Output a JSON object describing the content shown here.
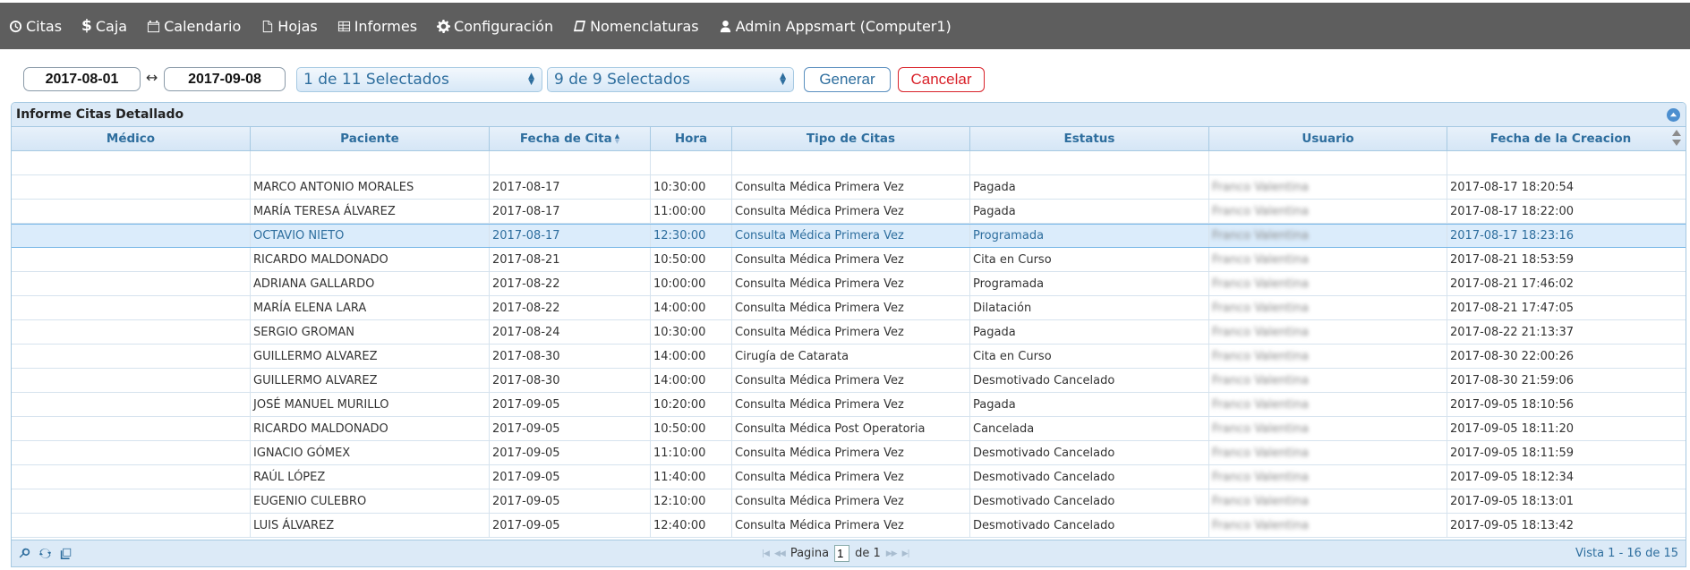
{
  "nav": {
    "items": [
      {
        "label": "Citas",
        "icon": "clock-icon"
      },
      {
        "label": "Caja",
        "icon": "dollar-icon"
      },
      {
        "label": "Calendario",
        "icon": "calendar-icon"
      },
      {
        "label": "Hojas",
        "icon": "file-icon"
      },
      {
        "label": "Informes",
        "icon": "table-icon"
      },
      {
        "label": "Configuración",
        "icon": "gear-icon"
      },
      {
        "label": "Nomenclaturas",
        "icon": "book-icon"
      },
      {
        "label": "Admin Appsmart (Computer1)",
        "icon": "user-icon"
      }
    ]
  },
  "filters": {
    "date_from": "2017-08-01",
    "date_sep": "↔",
    "date_to": "2017-09-08",
    "select1": "1 de 11 Selectados",
    "select2": "9 de 9 Selectados",
    "generate": "Generar",
    "cancel": "Cancelar"
  },
  "grid": {
    "caption": "Informe Citas Detallado",
    "columns": [
      "Médico",
      "Paciente",
      "Fecha de Cita",
      "Hora",
      "Tipo de Citas",
      "Estatus",
      "Usuario",
      "Fecha de la Creacion"
    ],
    "rows": [
      {
        "medico": "",
        "paciente": "MARCO ANTONIO MORALES",
        "fecha": "2017-08-17",
        "hora": "10:30:00",
        "tipo": "Consulta Médica Primera Vez",
        "estatus": "Pagada",
        "usuario": "Franco Valentina",
        "creacion": "2017-08-17 18:20:54"
      },
      {
        "medico": "",
        "paciente": "MARÍA TERESA ÁLVAREZ",
        "fecha": "2017-08-17",
        "hora": "11:00:00",
        "tipo": "Consulta Médica Primera Vez",
        "estatus": "Pagada",
        "usuario": "Franco Valentina",
        "creacion": "2017-08-17 18:22:00"
      },
      {
        "medico": "",
        "paciente": "OCTAVIO NIETO",
        "fecha": "2017-08-17",
        "hora": "12:30:00",
        "tipo": "Consulta Médica Primera Vez",
        "estatus": "Programada",
        "usuario": "Franco Valentina",
        "creacion": "2017-08-17 18:23:16"
      },
      {
        "medico": "",
        "paciente": "RICARDO MALDONADO",
        "fecha": "2017-08-21",
        "hora": "10:50:00",
        "tipo": "Consulta Médica Primera Vez",
        "estatus": "Cita en Curso",
        "usuario": "Franco Valentina",
        "creacion": "2017-08-21 18:53:59"
      },
      {
        "medico": "",
        "paciente": "ADRIANA GALLARDO",
        "fecha": "2017-08-22",
        "hora": "10:00:00",
        "tipo": "Consulta Médica Primera Vez",
        "estatus": "Programada",
        "usuario": "Franco Valentina",
        "creacion": "2017-08-21 17:46:02"
      },
      {
        "medico": "",
        "paciente": "MARÍA ELENA LARA",
        "fecha": "2017-08-22",
        "hora": "14:00:00",
        "tipo": "Consulta Médica Primera Vez",
        "estatus": "Dilatación",
        "usuario": "Franco Valentina",
        "creacion": "2017-08-21 17:47:05"
      },
      {
        "medico": "",
        "paciente": "SERGIO GROMAN",
        "fecha": "2017-08-24",
        "hora": "10:30:00",
        "tipo": "Consulta Médica Primera Vez",
        "estatus": "Pagada",
        "usuario": "Franco Valentina",
        "creacion": "2017-08-22 21:13:37"
      },
      {
        "medico": "",
        "paciente": "GUILLERMO ALVAREZ",
        "fecha": "2017-08-30",
        "hora": "14:00:00",
        "tipo": "Cirugía de Catarata",
        "estatus": "Cita en Curso",
        "usuario": "Franco Valentina",
        "creacion": "2017-08-30 22:00:26"
      },
      {
        "medico": "",
        "paciente": "GUILLERMO ALVAREZ",
        "fecha": "2017-08-30",
        "hora": "14:00:00",
        "tipo": "Consulta Médica Primera Vez",
        "estatus": "Desmotivado Cancelado",
        "usuario": "Franco Valentina",
        "creacion": "2017-08-30 21:59:06"
      },
      {
        "medico": "",
        "paciente": "JOSÉ MANUEL MURILLO",
        "fecha": "2017-09-05",
        "hora": "10:20:00",
        "tipo": "Consulta Médica Primera Vez",
        "estatus": "Pagada",
        "usuario": "Franco Valentina",
        "creacion": "2017-09-05 18:10:56"
      },
      {
        "medico": "",
        "paciente": "RICARDO MALDONADO",
        "fecha": "2017-09-05",
        "hora": "10:50:00",
        "tipo": "Consulta Médica Post Operatoria",
        "estatus": "Cancelada",
        "usuario": "Franco Valentina",
        "creacion": "2017-09-05 18:11:20"
      },
      {
        "medico": "",
        "paciente": "IGNACIO GÓMEX",
        "fecha": "2017-09-05",
        "hora": "11:10:00",
        "tipo": "Consulta Médica Primera Vez",
        "estatus": "Desmotivado Cancelado",
        "usuario": "Franco Valentina",
        "creacion": "2017-09-05 18:11:59"
      },
      {
        "medico": "",
        "paciente": "RAÚL  LÓPEZ",
        "fecha": "2017-09-05",
        "hora": "11:40:00",
        "tipo": "Consulta Médica Primera Vez",
        "estatus": "Desmotivado Cancelado",
        "usuario": "Franco Valentina",
        "creacion": "2017-09-05 18:12:34"
      },
      {
        "medico": "",
        "paciente": "EUGENIO CULEBRO",
        "fecha": "2017-09-05",
        "hora": "12:10:00",
        "tipo": "Consulta Médica Primera Vez",
        "estatus": "Desmotivado Cancelado",
        "usuario": "Franco Valentina",
        "creacion": "2017-09-05 18:13:01"
      },
      {
        "medico": "",
        "paciente": "LUIS ÁLVAREZ",
        "fecha": "2017-09-05",
        "hora": "12:40:00",
        "tipo": "Consulta Médica Primera Vez",
        "estatus": "Desmotivado Cancelado",
        "usuario": "Franco Valentina",
        "creacion": "2017-09-05 18:13:42"
      }
    ],
    "selected_row": 2
  },
  "pager": {
    "page_label": "Pagina",
    "page_value": "1",
    "of_label": "de 1",
    "info": "Vista 1 - 16 de 15"
  },
  "colors": {
    "topbar": "#5e5e5e",
    "header_text": "#2e6e9e",
    "cancel": "#d9222a"
  }
}
